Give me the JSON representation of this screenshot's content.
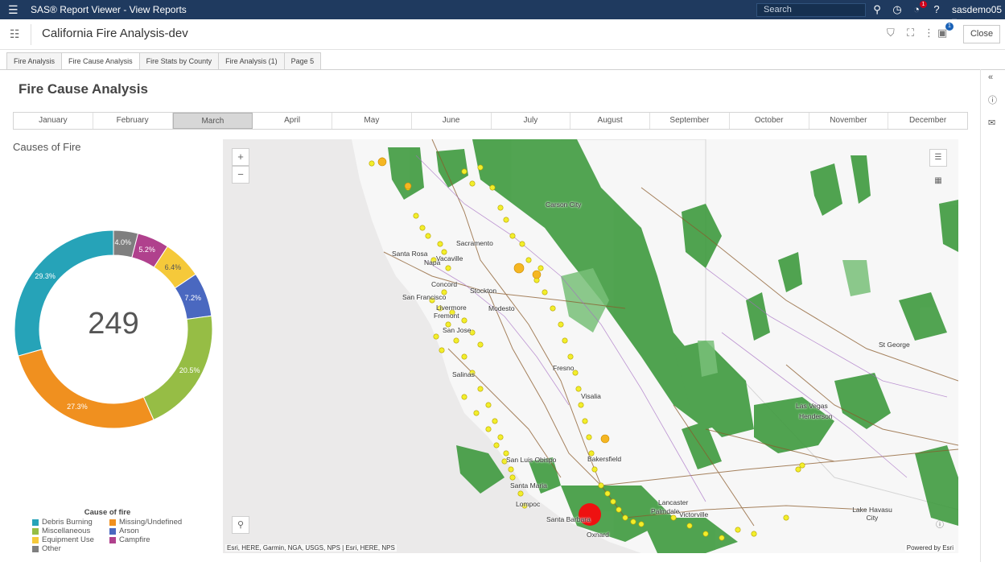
{
  "app": {
    "title": "SAS® Report Viewer - View Reports",
    "search_placeholder": "Search",
    "user": "sasdemo05",
    "notification_count": "1"
  },
  "report": {
    "title": "California Fire Analysis-dev",
    "close_label": "Close",
    "info_badge": "1"
  },
  "tabs": [
    {
      "label": "Fire Analysis",
      "active": false
    },
    {
      "label": "Fire Cause Analysis",
      "active": true
    },
    {
      "label": "Fire Stats by County",
      "active": false
    },
    {
      "label": "Fire Analysis (1)",
      "active": false
    },
    {
      "label": "Page 5",
      "active": false
    }
  ],
  "page": {
    "title": "Fire Cause Analysis",
    "selected_month": "March",
    "months": [
      "January",
      "February",
      "March",
      "April",
      "May",
      "June",
      "July",
      "August",
      "September",
      "October",
      "November",
      "December"
    ]
  },
  "donut": {
    "title": "Causes of Fire",
    "total": "249",
    "legend_title": "Cause of fire"
  },
  "chart_data": {
    "type": "pie",
    "title": "Causes of Fire",
    "center_label": "249",
    "slices": [
      {
        "name": "Other",
        "value": 4.0,
        "label": "4.0%",
        "color": "#7f7f7f"
      },
      {
        "name": "Campfire",
        "value": 5.2,
        "label": "5.2%",
        "color": "#b0418d"
      },
      {
        "name": "Equipment Use",
        "value": 6.4,
        "label": "6.4%",
        "color": "#f5c93a"
      },
      {
        "name": "Arson",
        "value": 7.2,
        "label": "7.2%",
        "color": "#4a68c0"
      },
      {
        "name": "Miscellaneous",
        "value": 20.5,
        "label": "20.5%",
        "color": "#96bd45"
      },
      {
        "name": "Missing/Undefined",
        "value": 27.3,
        "label": "27.3%",
        "color": "#f0901f"
      },
      {
        "name": "Debris Burning",
        "value": 29.3,
        "label": "29.3%",
        "color": "#26a3b8"
      }
    ],
    "legend": [
      "Debris Burning",
      "Missing/Undefined",
      "Miscellaneous",
      "Arson",
      "Equipment Use",
      "Campfire",
      "Other"
    ],
    "legend_title": "Cause of fire",
    "legend_position": "bottom"
  },
  "map": {
    "attribution": "Esri, HERE, Garmin, NGA, USGS, NPS | Esri, HERE, NPS",
    "powered_by": "Powered by Esri",
    "zoom_in": "+",
    "zoom_out": "−",
    "cities": [
      "Carson City",
      "Santa Rosa",
      "Napa",
      "Vacaville",
      "Sacramento",
      "Concord",
      "Stockton",
      "San Francisco",
      "Livermore",
      "Modesto",
      "Fremont",
      "San Jose",
      "Salinas",
      "Fresno",
      "Visalia",
      "Bakersfield",
      "San Luis Obispo",
      "Santa Maria",
      "Lompoc",
      "Santa Barbara",
      "Lancaster",
      "Palmdale",
      "Victorville",
      "Oxnard",
      "Las Vegas",
      "Henderson",
      "St George",
      "Lake Havasu City"
    ]
  }
}
